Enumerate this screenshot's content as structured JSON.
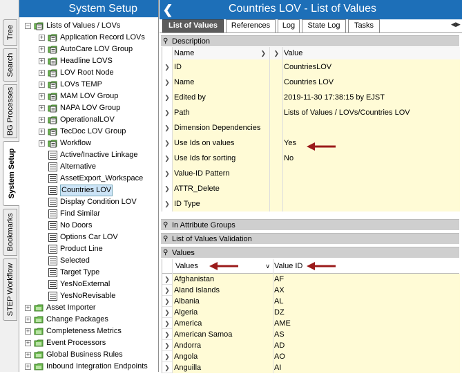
{
  "colors": {
    "header_blue": "#1d6fb8",
    "yellow_cell": "#fffbd6",
    "arrow_red": "#9b1b1b"
  },
  "vtabs": [
    {
      "label": "Tree"
    },
    {
      "label": "Search"
    },
    {
      "label": "BG Processes"
    },
    {
      "label": "System Setup"
    },
    {
      "label": "Bookmarks"
    },
    {
      "label": "STEP Workflow"
    }
  ],
  "tree": {
    "title": "System Setup",
    "nodes": [
      {
        "label": "Lists of Values / LOVs",
        "icon": "folder-lov-icon"
      },
      {
        "label": "Application Record LOVs",
        "icon": "folder-lov-icon"
      },
      {
        "label": "AutoCare LOV Group",
        "icon": "folder-lov-icon"
      },
      {
        "label": "Headline LOVS",
        "icon": "folder-lov-icon"
      },
      {
        "label": "LOV Root Node",
        "icon": "folder-lov-icon"
      },
      {
        "label": "LOVs TEMP",
        "icon": "folder-lov-icon"
      },
      {
        "label": "MAM LOV Group",
        "icon": "folder-lov-icon"
      },
      {
        "label": "NAPA LOV Group",
        "icon": "folder-lov-icon"
      },
      {
        "label": "OperationalLOV",
        "icon": "folder-lov-icon"
      },
      {
        "label": "TecDoc LOV Group",
        "icon": "folder-lov-icon"
      },
      {
        "label": "Workflow",
        "icon": "folder-lov-icon"
      },
      {
        "label": "Active/Inactive Linkage",
        "icon": "list-icon"
      },
      {
        "label": "Alternative",
        "icon": "list-icon"
      },
      {
        "label": "AssetExport_Workspace",
        "icon": "list-icon"
      },
      {
        "label": "Countries LOV",
        "icon": "list-icon"
      },
      {
        "label": "Display Condition LOV",
        "icon": "list-icon"
      },
      {
        "label": "Find Similar",
        "icon": "list-icon"
      },
      {
        "label": "No Doors",
        "icon": "list-icon"
      },
      {
        "label": "Options Car LOV",
        "icon": "list-icon"
      },
      {
        "label": "Product Line",
        "icon": "list-icon"
      },
      {
        "label": "Selected",
        "icon": "list-icon"
      },
      {
        "label": "Target Type",
        "icon": "list-icon"
      },
      {
        "label": "YesNoExternal",
        "icon": "list-icon"
      },
      {
        "label": "YesNoRevisable",
        "icon": "list-icon"
      },
      {
        "label": "Asset Importer",
        "icon": "folder-green-icon"
      },
      {
        "label": "Change Packages",
        "icon": "folder-green-icon"
      },
      {
        "label": "Completeness Metrics",
        "icon": "folder-green-icon"
      },
      {
        "label": "Event Processors",
        "icon": "folder-green-icon"
      },
      {
        "label": "Global Business Rules",
        "icon": "folder-green-icon"
      },
      {
        "label": "Inbound Integration Endpoints",
        "icon": "folder-green-icon"
      }
    ]
  },
  "main": {
    "title": "Countries LOV - List of Values",
    "tabs": [
      "List of Values",
      "References",
      "Log",
      "State Log",
      "Tasks"
    ],
    "sections": {
      "description": "Description",
      "attr_groups": "In Attribute Groups",
      "validation": "List of Values Validation",
      "values": "Values"
    },
    "desc_headers": {
      "name": "Name",
      "value": "Value"
    },
    "desc_rows": [
      {
        "name": "ID",
        "value": "CountriesLOV"
      },
      {
        "name": "Name",
        "value": "Countries LOV"
      },
      {
        "name": "Edited by",
        "value": "2019-11-30 17:38:15 by EJST"
      },
      {
        "name": "Path",
        "value": "Lists of Values / LOVs/Countries LOV"
      },
      {
        "name": "Dimension Dependencies",
        "value": ""
      },
      {
        "name": "Use Ids on values",
        "value": "Yes"
      },
      {
        "name": "Use Ids for sorting",
        "value": "No"
      },
      {
        "name": "Value-ID Pattern",
        "value": ""
      },
      {
        "name": "ATTR_Delete",
        "value": ""
      },
      {
        "name": "ID Type",
        "value": ""
      }
    ],
    "value_headers": {
      "values": "Values",
      "value_id": "Value ID"
    },
    "value_rows": [
      {
        "value": "Afghanistan",
        "id": "AF"
      },
      {
        "value": "Aland Islands",
        "id": "AX"
      },
      {
        "value": "Albania",
        "id": "AL"
      },
      {
        "value": "Algeria",
        "id": "DZ"
      },
      {
        "value": "America",
        "id": "AME"
      },
      {
        "value": "American Samoa",
        "id": "AS"
      },
      {
        "value": "Andorra",
        "id": "AD"
      },
      {
        "value": "Angola",
        "id": "AO"
      },
      {
        "value": "Anguilla",
        "id": "AI"
      }
    ]
  }
}
